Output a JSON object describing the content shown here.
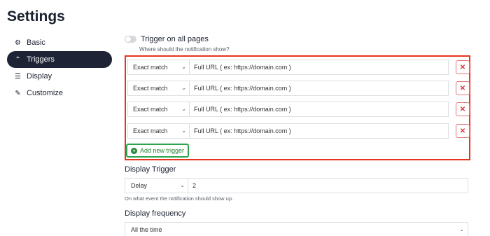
{
  "page": {
    "title": "Settings"
  },
  "sidebar": {
    "items": [
      {
        "label": "Basic",
        "icon": "gear-icon",
        "active": false
      },
      {
        "label": "Triggers",
        "icon": "chevron-up-icon",
        "active": true
      },
      {
        "label": "Display",
        "icon": "sliders-icon",
        "active": false
      },
      {
        "label": "Customize",
        "icon": "brush-icon",
        "active": false
      }
    ]
  },
  "trigger_all": {
    "label": "Trigger on all pages",
    "enabled": false,
    "help": "Where should the notification show?"
  },
  "triggers": [
    {
      "match": "Exact match",
      "placeholder": "Full URL ( ex: https://domain.com )"
    },
    {
      "match": "Exact match",
      "placeholder": "Full URL ( ex: https://domain.com )"
    },
    {
      "match": "Exact match",
      "placeholder": "Full URL ( ex: https://domain.com )"
    },
    {
      "match": "Exact match",
      "placeholder": "Full URL ( ex: https://domain.com )"
    }
  ],
  "add_trigger": {
    "label": "Add new trigger"
  },
  "display_trigger": {
    "label": "Display Trigger",
    "type": "Delay",
    "value": "2",
    "help": "On what event the notification should show up."
  },
  "display_frequency": {
    "label": "Display frequency",
    "value": "All the time"
  },
  "colors": {
    "active_nav_bg": "#1e2336",
    "highlight_border": "#e8331f",
    "add_button": "#2ea44f",
    "remove_button": "#d9343e"
  }
}
